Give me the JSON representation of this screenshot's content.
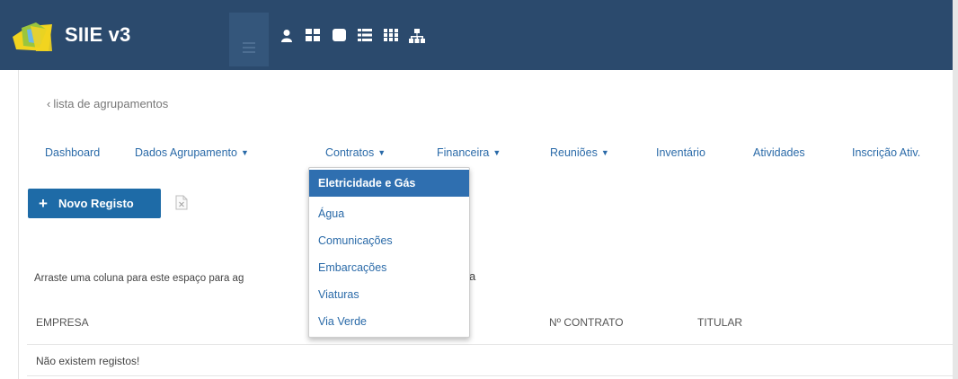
{
  "app": {
    "title": "SIIE v3"
  },
  "toolbar": {
    "icons": [
      "menu-icon",
      "user-icon",
      "grid-icon",
      "square-icon",
      "list-icon",
      "table-icon",
      "sitemap-icon"
    ]
  },
  "breadcrumb": {
    "back_label": "lista de agrupamentos"
  },
  "tabs": [
    {
      "label": "Dashboard",
      "has_caret": false
    },
    {
      "label": "Dados Agrupamento",
      "has_caret": true
    },
    {
      "label": "Contratos",
      "has_caret": true
    },
    {
      "label": "Financeira",
      "has_caret": true
    },
    {
      "label": "Reuniões",
      "has_caret": true
    },
    {
      "label": "Inventário",
      "has_caret": false
    },
    {
      "label": "Atividades",
      "has_caret": false
    },
    {
      "label": "Inscrição Ativ.",
      "has_caret": false
    }
  ],
  "contratos_menu": {
    "items": [
      "Eletricidade e Gás",
      "Água",
      "Comunicações",
      "Embarcações",
      "Viaturas",
      "Via Verde"
    ],
    "active_index": 0
  },
  "actions": {
    "new_record_label": "Novo Registo"
  },
  "grid": {
    "grouping_hint": "Arraste uma coluna para este espaço para ag",
    "grouping_hint_tail": "a",
    "columns": [
      "EMPRESA",
      "Nº CONTRATO",
      "TITULAR"
    ],
    "empty_message": "Não existem registos!"
  },
  "colors": {
    "topbar": "#2b4a6d",
    "accent": "#1e6ba7",
    "link": "#2a6aa8",
    "menu_active": "#2f6fb0"
  }
}
